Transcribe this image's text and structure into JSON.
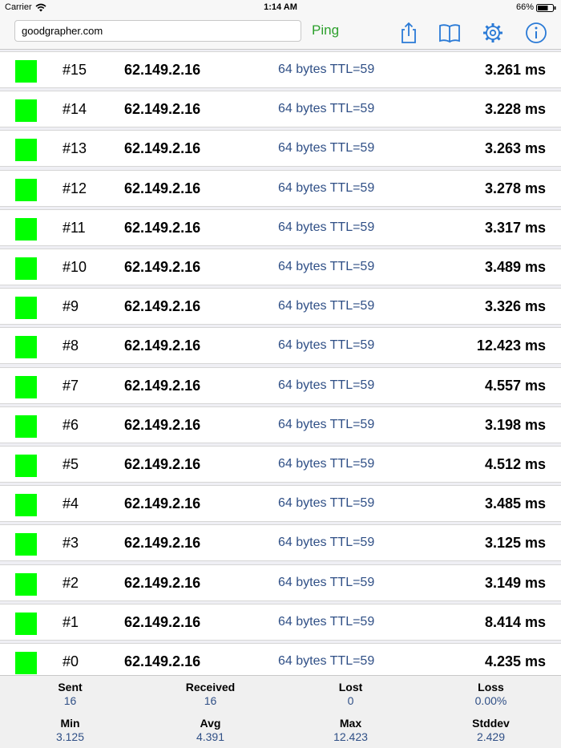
{
  "status_bar": {
    "carrier": "Carrier",
    "time": "1:14 AM",
    "battery": "66%"
  },
  "toolbar": {
    "host_value": "goodgrapher.com",
    "ping_label": "Ping",
    "icons": [
      "share-icon",
      "book-icon",
      "gear-icon",
      "info-icon"
    ]
  },
  "rows": [
    {
      "seq": "#15",
      "ip": "62.149.2.16",
      "bytes": "64 bytes TTL=59",
      "time": "3.261 ms"
    },
    {
      "seq": "#14",
      "ip": "62.149.2.16",
      "bytes": "64 bytes TTL=59",
      "time": "3.228 ms"
    },
    {
      "seq": "#13",
      "ip": "62.149.2.16",
      "bytes": "64 bytes TTL=59",
      "time": "3.263 ms"
    },
    {
      "seq": "#12",
      "ip": "62.149.2.16",
      "bytes": "64 bytes TTL=59",
      "time": "3.278 ms"
    },
    {
      "seq": "#11",
      "ip": "62.149.2.16",
      "bytes": "64 bytes TTL=59",
      "time": "3.317 ms"
    },
    {
      "seq": "#10",
      "ip": "62.149.2.16",
      "bytes": "64 bytes TTL=59",
      "time": "3.489 ms"
    },
    {
      "seq": "#9",
      "ip": "62.149.2.16",
      "bytes": "64 bytes TTL=59",
      "time": "3.326 ms"
    },
    {
      "seq": "#8",
      "ip": "62.149.2.16",
      "bytes": "64 bytes TTL=59",
      "time": "12.423 ms"
    },
    {
      "seq": "#7",
      "ip": "62.149.2.16",
      "bytes": "64 bytes TTL=59",
      "time": "4.557 ms"
    },
    {
      "seq": "#6",
      "ip": "62.149.2.16",
      "bytes": "64 bytes TTL=59",
      "time": "3.198 ms"
    },
    {
      "seq": "#5",
      "ip": "62.149.2.16",
      "bytes": "64 bytes TTL=59",
      "time": "4.512 ms"
    },
    {
      "seq": "#4",
      "ip": "62.149.2.16",
      "bytes": "64 bytes TTL=59",
      "time": "3.485 ms"
    },
    {
      "seq": "#3",
      "ip": "62.149.2.16",
      "bytes": "64 bytes TTL=59",
      "time": "3.125 ms"
    },
    {
      "seq": "#2",
      "ip": "62.149.2.16",
      "bytes": "64 bytes TTL=59",
      "time": "3.149 ms"
    },
    {
      "seq": "#1",
      "ip": "62.149.2.16",
      "bytes": "64 bytes TTL=59",
      "time": "8.414 ms"
    },
    {
      "seq": "#0",
      "ip": "62.149.2.16",
      "bytes": "64 bytes TTL=59",
      "time": "4.235 ms"
    }
  ],
  "row_status_color": "#00ff00",
  "stats": {
    "sent": {
      "label": "Sent",
      "value": "16"
    },
    "received": {
      "label": "Received",
      "value": "16"
    },
    "lost": {
      "label": "Lost",
      "value": "0"
    },
    "loss": {
      "label": "Loss",
      "value": "0.00%"
    },
    "min": {
      "label": "Min",
      "value": "3.125"
    },
    "avg": {
      "label": "Avg",
      "value": "4.391"
    },
    "max": {
      "label": "Max",
      "value": "12.423"
    },
    "stddev": {
      "label": "Stddev",
      "value": "2.429"
    }
  },
  "colors": {
    "accent": "#2a7ad6",
    "ping_green": "#2ca02c",
    "value_blue": "#2f4f86"
  }
}
